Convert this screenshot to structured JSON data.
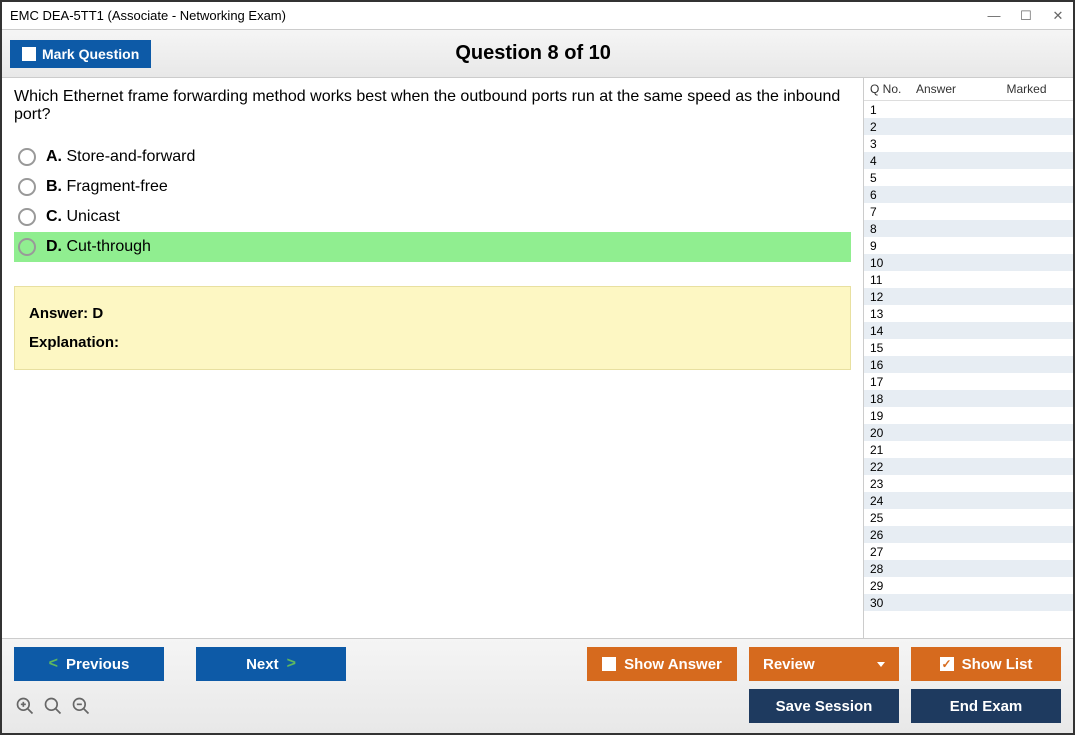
{
  "window": {
    "title": "EMC DEA-5TT1 (Associate - Networking Exam)"
  },
  "header": {
    "mark_label": "Mark Question",
    "counter": "Question 8 of 10"
  },
  "question": {
    "text": "Which Ethernet frame forwarding method works best when the outbound ports run at the same speed as the inbound port?",
    "options": [
      {
        "letter": "A.",
        "text": "Store-and-forward",
        "highlight": false
      },
      {
        "letter": "B.",
        "text": "Fragment-free",
        "highlight": false
      },
      {
        "letter": "C.",
        "text": "Unicast",
        "highlight": false
      },
      {
        "letter": "D.",
        "text": "Cut-through",
        "highlight": true
      }
    ],
    "answer_line": "Answer: D",
    "explanation_label": "Explanation:"
  },
  "side": {
    "headers": {
      "q": "Q No.",
      "a": "Answer",
      "m": "Marked"
    },
    "count": 30
  },
  "footer": {
    "previous": "Previous",
    "next": "Next",
    "show_answer": "Show Answer",
    "review": "Review",
    "show_list": "Show List",
    "save_session": "Save Session",
    "end_exam": "End Exam"
  }
}
